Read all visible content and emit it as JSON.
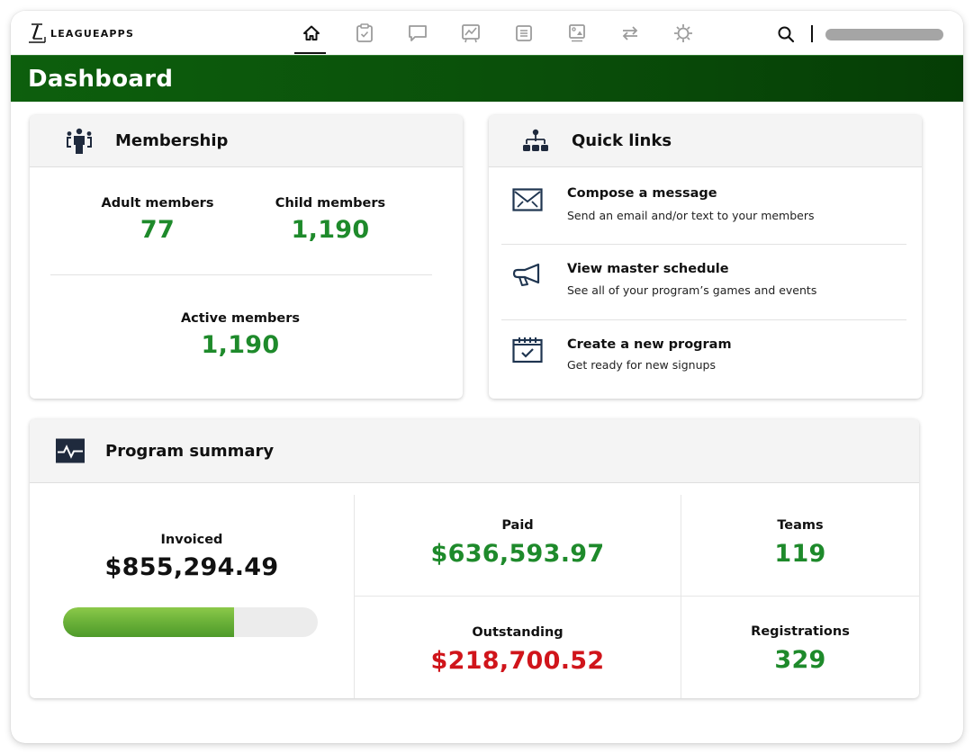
{
  "app": {
    "brand": "LEAGUEAPPS"
  },
  "nav": {
    "items": [
      {
        "name": "home",
        "icon": "home-icon",
        "active": true
      },
      {
        "name": "registrations",
        "icon": "clipboard-check-icon",
        "active": false
      },
      {
        "name": "messages",
        "icon": "chat-bubble-icon",
        "active": false
      },
      {
        "name": "reports",
        "icon": "chart-board-icon",
        "active": false
      },
      {
        "name": "documents",
        "icon": "document-list-icon",
        "active": false
      },
      {
        "name": "media",
        "icon": "image-icon",
        "active": false
      },
      {
        "name": "transfers",
        "icon": "swap-arrows-icon",
        "active": false
      },
      {
        "name": "settings",
        "icon": "gear-icon",
        "active": false
      }
    ],
    "search_icon": "search-icon",
    "user_name": ""
  },
  "header": {
    "title": "Dashboard",
    "accent": "#0a4f0a"
  },
  "membership": {
    "title": "Membership",
    "icon": "group-icon",
    "adult": {
      "label": "Adult members",
      "value": "77"
    },
    "child": {
      "label": "Child members",
      "value": "1,190"
    },
    "active": {
      "label": "Active members",
      "value": "1,190"
    }
  },
  "quick_links": {
    "title": "Quick links",
    "icon": "sitemap-icon",
    "items": [
      {
        "icon": "envelope-icon",
        "title": "Compose a message",
        "subtitle": "Send an email and/or text to your members"
      },
      {
        "icon": "megaphone-icon",
        "title": "View master schedule",
        "subtitle": "See all of your program’s games and events"
      },
      {
        "icon": "calendar-check-icon",
        "title": "Create a new program",
        "subtitle": "Get ready for new signups"
      }
    ]
  },
  "program_summary": {
    "title": "Program summary",
    "icon": "pulse-icon",
    "invoiced": {
      "label": "Invoiced",
      "value": "$855,294.49"
    },
    "paid_fraction": 0.67,
    "paid": {
      "label": "Paid",
      "value": "$636,593.97"
    },
    "outstanding": {
      "label": "Outstanding",
      "value": "$218,700.52"
    },
    "teams": {
      "label": "Teams",
      "value": "119"
    },
    "registrations": {
      "label": "Registrations",
      "value": "329"
    }
  },
  "colors": {
    "positive": "#1e8a2b",
    "negative": "#d0151b",
    "progress": "#6db33a",
    "icon": "#1f2a3d"
  }
}
